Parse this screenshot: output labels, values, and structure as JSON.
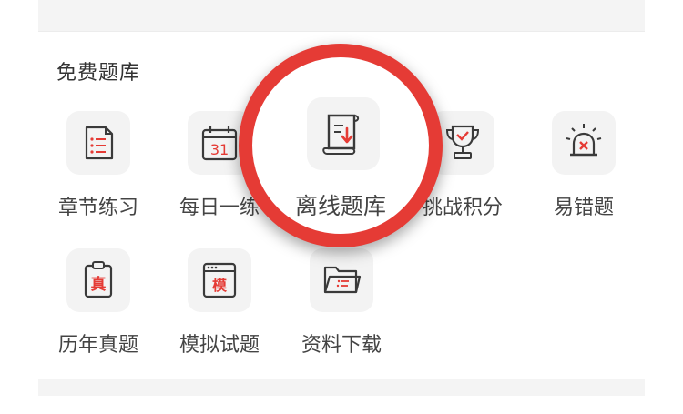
{
  "section": {
    "title": "免费题库"
  },
  "tiles": [
    {
      "label": "章节练习",
      "icon": "chapter-list-icon"
    },
    {
      "label": "每日一练",
      "icon": "calendar-icon",
      "icon_text": "31"
    },
    {
      "label": "离线题库",
      "icon": "offline-download-icon"
    },
    {
      "label": "挑战积分",
      "icon": "trophy-icon"
    },
    {
      "label": "易错题",
      "icon": "alarm-light-icon"
    },
    {
      "label": "历年真题",
      "icon": "clipboard-icon",
      "icon_text": "真"
    },
    {
      "label": "模拟试题",
      "icon": "browser-window-icon",
      "icon_text": "模"
    },
    {
      "label": "资料下载",
      "icon": "folder-icon"
    }
  ],
  "colors": {
    "accent": "#e53b35",
    "icon_stroke": "#3a3a3a",
    "tile_bg": "#f3f3f3",
    "label": "#444444"
  }
}
